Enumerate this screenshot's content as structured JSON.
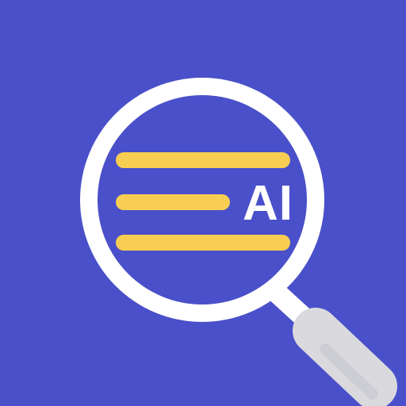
{
  "app_icon": {
    "name": "magnifying-glass-ai-icon",
    "badge_text": "AI",
    "lines_count": 3,
    "colors": {
      "background": "#4a50c9",
      "lens_fill": "#4a50c9",
      "ring": "#ffffff",
      "text_lines": "#f8ce52",
      "badge_text": "#ffffff",
      "handle": "#d9d9de",
      "handle_shadow": "#bfc0c6",
      "neck": "#ffffff"
    }
  }
}
